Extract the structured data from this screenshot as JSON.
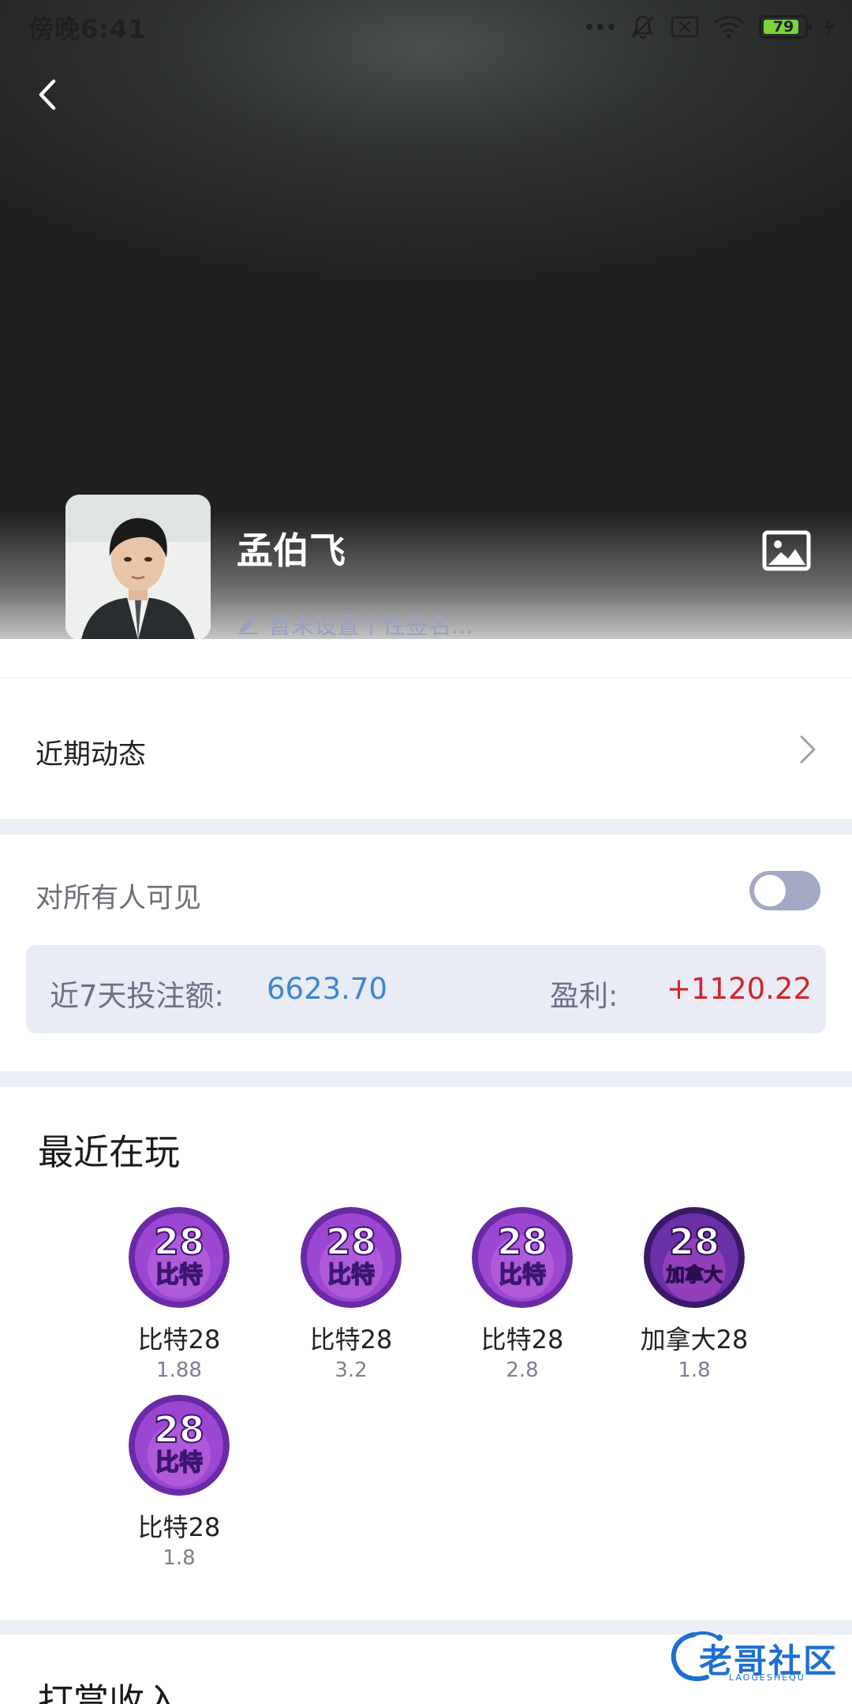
{
  "status_bar": {
    "time": "傍晚6:41",
    "battery": "79",
    "icons": [
      "more-dots-icon",
      "bell-muted-icon",
      "sim-x-icon",
      "wifi-icon",
      "battery-icon",
      "charging-icon"
    ]
  },
  "profile": {
    "name": "孟伯飞",
    "signature_placeholder": "暂未设置个性签名..."
  },
  "rows": {
    "recent_activity": "近期动态",
    "visibility": "对所有人可见"
  },
  "stats": {
    "bet_label": "近7天投注额:",
    "bet_value": "6623.70",
    "profit_label": "盈利:",
    "profit_value": "+1120.22"
  },
  "recent_games": {
    "title": "最近在玩",
    "items": [
      {
        "name": "比特28",
        "odds": "1.88",
        "badge": "比特"
      },
      {
        "name": "比特28",
        "odds": "3.2",
        "badge": "比特"
      },
      {
        "name": "比特28",
        "odds": "2.8",
        "badge": "比特"
      },
      {
        "name": "加拿大28",
        "odds": "1.8",
        "badge": "加拿大"
      },
      {
        "name": "比特28",
        "odds": "1.8",
        "badge": "比特"
      }
    ]
  },
  "tip_income": {
    "title": "打赏收入"
  },
  "watermark": {
    "text": "老哥社区",
    "sub": "LAOGESHEQU"
  },
  "colors": {
    "accent_blue": "#3b86d1",
    "profit_red": "#d3242c",
    "game_purple": "#8c3fc8"
  }
}
